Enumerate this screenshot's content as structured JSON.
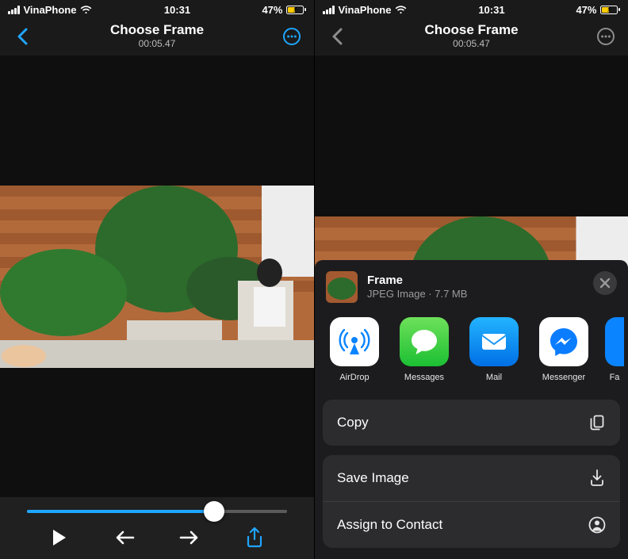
{
  "status": {
    "carrier": "VinaPhone",
    "time": "10:31",
    "battery_pct": "47%"
  },
  "header": {
    "title": "Choose Frame",
    "timecode": "00:05.47"
  },
  "controls": {
    "play_icon": "play",
    "prev_icon": "arrow-left",
    "next_icon": "arrow-right",
    "share_icon": "share"
  },
  "share": {
    "title": "Frame",
    "subtitle": "JPEG Image · 7.7 MB",
    "apps": [
      {
        "label": "AirDrop",
        "icon": "airdrop"
      },
      {
        "label": "Messages",
        "icon": "messages"
      },
      {
        "label": "Mail",
        "icon": "mail"
      },
      {
        "label": "Messenger",
        "icon": "messenger"
      },
      {
        "label": "Fa",
        "icon": "next"
      }
    ],
    "actions": [
      {
        "label": "Copy",
        "icon": "copy"
      },
      {
        "label": "Save Image",
        "icon": "download"
      },
      {
        "label": "Assign to Contact",
        "icon": "contact"
      }
    ]
  }
}
